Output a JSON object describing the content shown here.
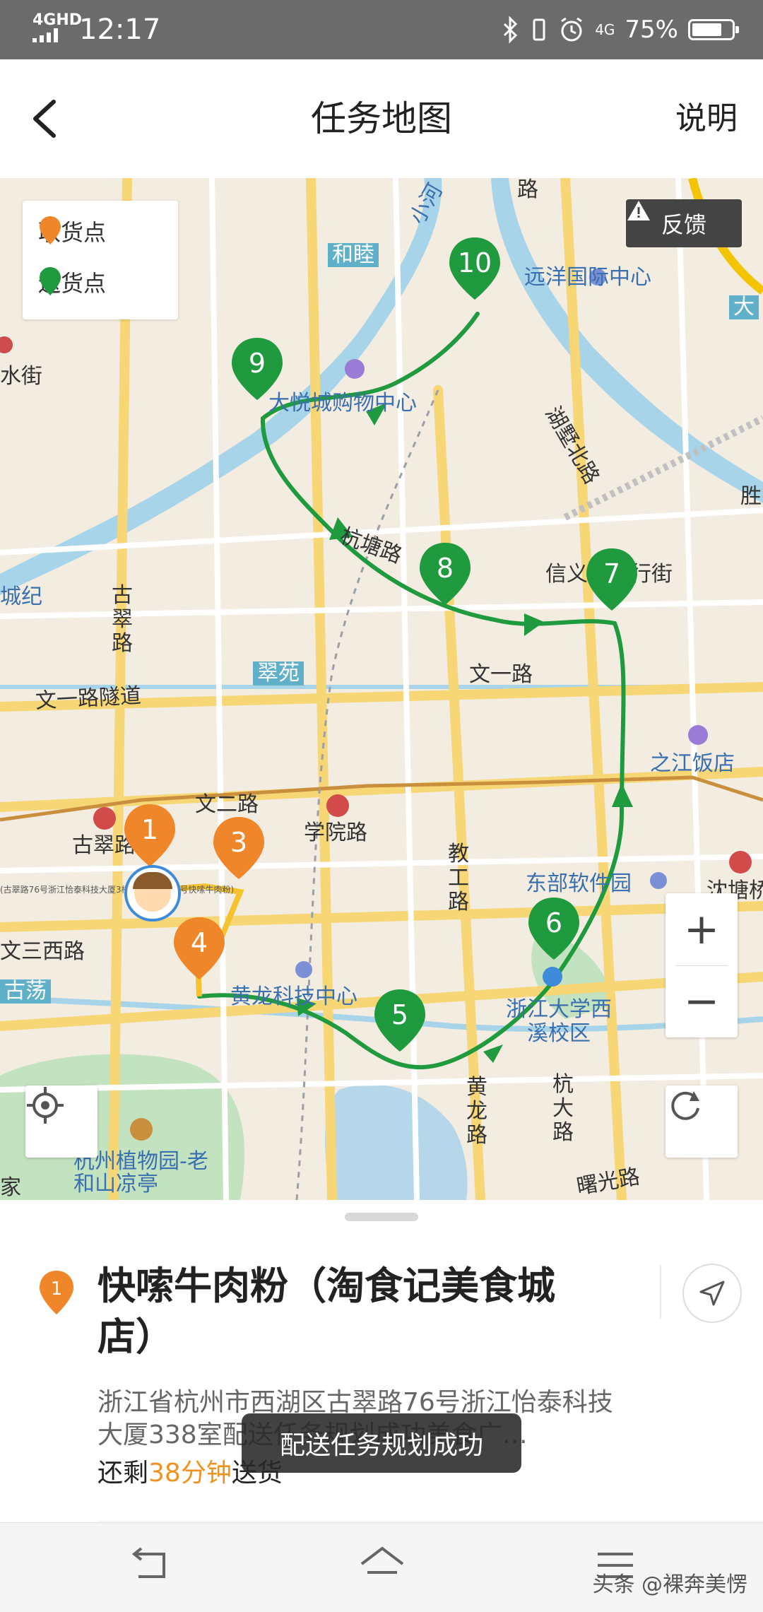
{
  "status_bar": {
    "network": "4GHD",
    "time": "12:17",
    "cell_type": "4G",
    "battery_percent": "75%",
    "battery_level": 0.75
  },
  "header": {
    "title": "任务地图",
    "help_label": "说明"
  },
  "map": {
    "legend": {
      "pickup_label": "取货点",
      "delivery_label": "送货点",
      "pickup_color": "#f0862a",
      "delivery_color": "#1f9a3e"
    },
    "feedback_label": "反馈",
    "route_color": "#1f9a3e",
    "pickup_markers": [
      "1",
      "3",
      "4"
    ],
    "delivery_markers": [
      "5",
      "6",
      "7",
      "8",
      "9",
      "10"
    ],
    "place_labels": {
      "hemu": "和睦",
      "xiaohe": "小河",
      "yuanyang": "远洋国际中心",
      "dayue": "大悦城购物中心",
      "hushu": "湖墅北路",
      "hangtang": "杭塘路",
      "xinyi": "信义坊步行街",
      "shui": "水街",
      "chengji": "城纪",
      "gucui": "古翠路",
      "cuiyuan": "翠苑",
      "wenyi_tunnel": "文一路隧道",
      "wenyi": "文一路",
      "zhijiang": "之江饭店",
      "wener": "文二路",
      "xueyuan": "学院路",
      "jiaogong": "教工路",
      "dongbu": "东部软件园",
      "shentang": "沈塘桥",
      "wensan": "文三西路",
      "gudang": "古荡",
      "huanglong_ke": "黄龙科技中心",
      "zju": "浙江大学西溪校区",
      "huanglong_rd": "黄龙路",
      "hangda": "杭大路",
      "shuguang": "曙光路",
      "botanical": "杭州植物园-老和山凉亭",
      "jia": "家",
      "sheng": "胜",
      "da": "大",
      "lu": "路",
      "mini_addr": "(古翠路76号浙江恰泰科技大厦3楼美食广场335号快嗦牛肉粉)"
    },
    "zoom_in": "+",
    "zoom_out": "−"
  },
  "detail": {
    "marker_number": "1",
    "store_name": "快嗦牛肉粉（淘食记美食城店）",
    "address": "浙江省杭州市西湖区古翠路76号浙江怡泰科技大厦338室配送任务规划成功美食广…",
    "remaining_prefix": "还剩",
    "remaining_time": "38分钟",
    "remaining_suffix": "送货"
  },
  "toast": "配送任务规划成功",
  "watermark": "头条 @裸奔美愣"
}
